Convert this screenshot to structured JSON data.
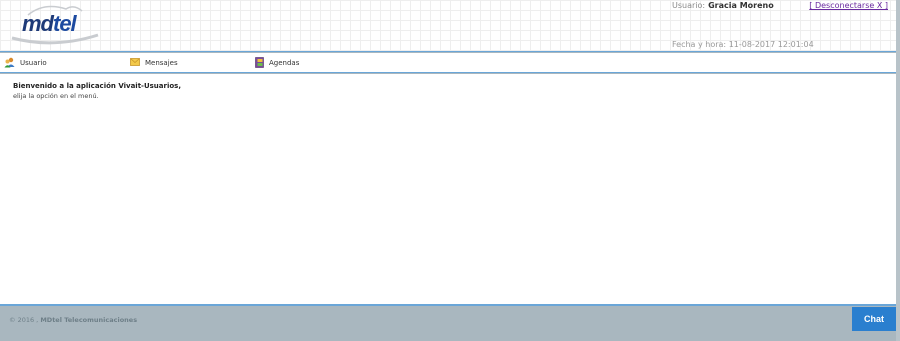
{
  "header": {
    "logo": {
      "part1": "md",
      "part2": "tel"
    },
    "user_label": "Usuario:",
    "user_name": "Gracia Moreno",
    "logout_label": "[ Desconectarse X ]",
    "datetime_label": "Fecha y hora:",
    "datetime_value": "11-08-2017 12:01:04"
  },
  "menu": {
    "items": [
      {
        "label": "Usuario",
        "icon": "users-icon"
      },
      {
        "label": "Mensajes",
        "icon": "envelope-icon"
      },
      {
        "label": "Agendas",
        "icon": "address-book-icon"
      }
    ]
  },
  "main": {
    "welcome": "Bienvenido a la aplicación Vivait-Usuarios,",
    "hint": "elija la opción en el menú."
  },
  "footer": {
    "copyright_prefix": "© 2016 ,",
    "company": "MDtel Telecomunicaciones"
  },
  "chat": {
    "label": "Chat"
  },
  "colors": {
    "accent": "#2a7fcf",
    "divider": "#6aa6d8",
    "footer_bg": "#a9b7bf",
    "logout_link": "#6a2aa0"
  }
}
